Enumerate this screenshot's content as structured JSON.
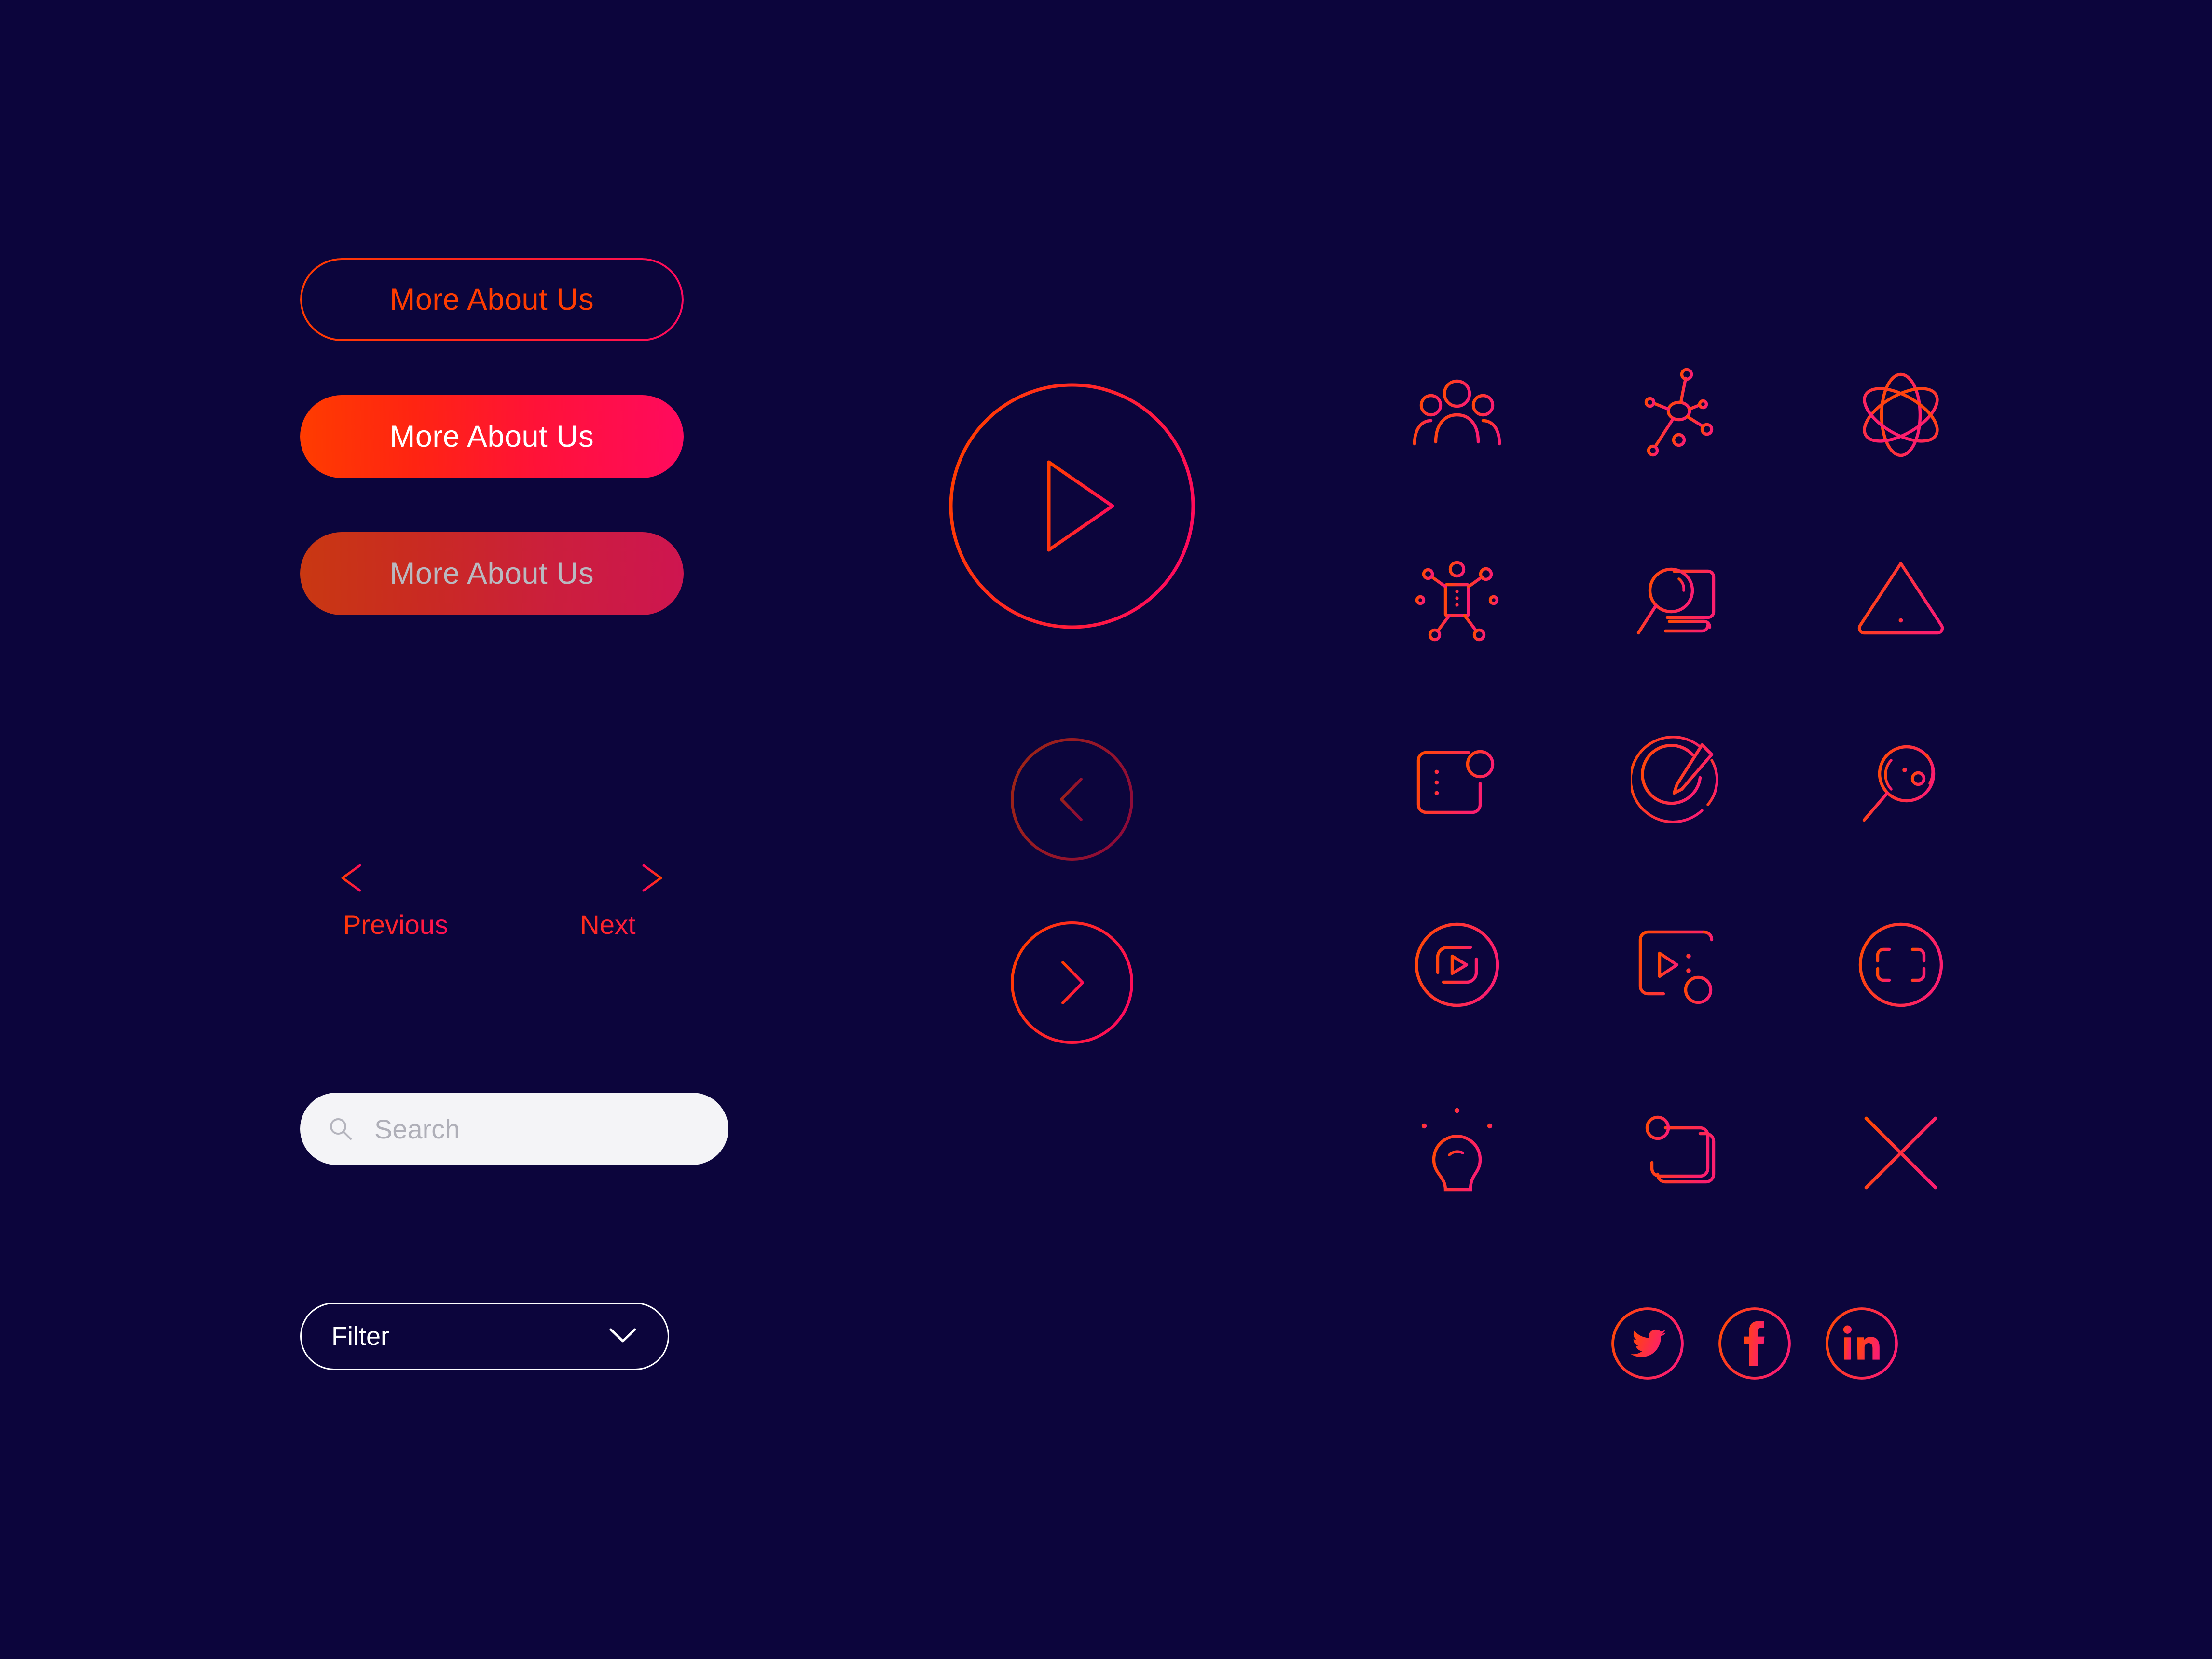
{
  "theme": {
    "background": "#0C053C",
    "gradient_start": "#FF3C00",
    "gradient_end": "#FF0A5E",
    "disabled_start": "#C93812",
    "disabled_end": "#CE1550",
    "disabled_text": "#B9B9C0",
    "white": "#FFFFFF",
    "search_bg": "#F4F4F7",
    "search_placeholder": "#AFAFB8"
  },
  "buttons": {
    "outline": {
      "label": "More About Us",
      "state": "default",
      "style": "outline"
    },
    "filled": {
      "label": "More About Us",
      "state": "active",
      "style": "filled-gradient"
    },
    "disabled": {
      "label": "More About Us",
      "state": "disabled",
      "style": "muted-gradient"
    }
  },
  "pagination": {
    "previous": {
      "label": "Previous",
      "icon": "arrow-left-icon"
    },
    "next": {
      "label": "Next",
      "icon": "arrow-right-icon"
    }
  },
  "search": {
    "placeholder": "Search",
    "value": "",
    "icon": "search-icon"
  },
  "filter": {
    "label": "Filter",
    "icon": "chevron-down-icon",
    "expanded": false
  },
  "media_controls": {
    "play": {
      "icon": "play-icon",
      "state": "default"
    },
    "prev_circle": {
      "icon": "chevron-left-icon",
      "state": "disabled"
    },
    "next_circle": {
      "icon": "chevron-right-icon",
      "state": "default"
    }
  },
  "icon_grid": {
    "columns": 3,
    "rows": 5,
    "items": [
      {
        "name": "users-group-icon",
        "row": 1,
        "col": 1
      },
      {
        "name": "network-hub-icon",
        "row": 1,
        "col": 2
      },
      {
        "name": "atom-icon",
        "row": 1,
        "col": 3
      },
      {
        "name": "server-nodes-icon",
        "row": 2,
        "col": 1
      },
      {
        "name": "search-document-icon",
        "row": 2,
        "col": 2
      },
      {
        "name": "warning-triangle-icon",
        "row": 2,
        "col": 3
      },
      {
        "name": "list-card-icon",
        "row": 3,
        "col": 1
      },
      {
        "name": "edit-pencil-icon",
        "row": 3,
        "col": 2
      },
      {
        "name": "search-data-icon",
        "row": 3,
        "col": 3
      },
      {
        "name": "play-circle-icon",
        "row": 4,
        "col": 1
      },
      {
        "name": "media-card-icon",
        "row": 4,
        "col": 2
      },
      {
        "name": "scan-frame-icon",
        "row": 4,
        "col": 3
      },
      {
        "name": "lightbulb-icon",
        "row": 5,
        "col": 1
      },
      {
        "name": "stack-layers-icon",
        "row": 5,
        "col": 2
      },
      {
        "name": "close-x-icon",
        "row": 5,
        "col": 3
      }
    ]
  },
  "social": {
    "items": [
      {
        "name": "twitter-icon",
        "label": "Twitter"
      },
      {
        "name": "facebook-icon",
        "label": "Facebook"
      },
      {
        "name": "linkedin-icon",
        "label": "LinkedIn"
      }
    ]
  }
}
